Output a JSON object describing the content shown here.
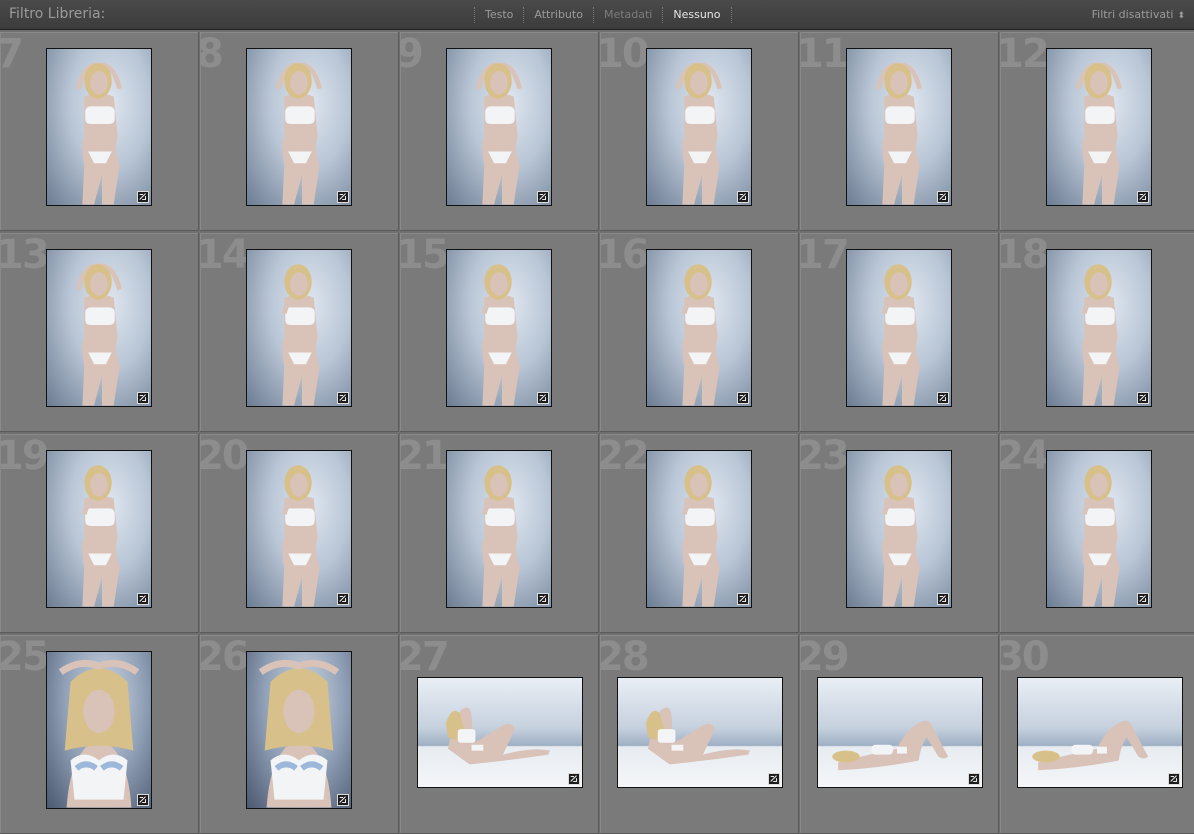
{
  "filter_bar": {
    "title": "Filtro Libreria:",
    "modes": [
      {
        "label": "Testo",
        "state": "normal"
      },
      {
        "label": "Attributo",
        "state": "normal"
      },
      {
        "label": "Metadati",
        "state": "dim"
      },
      {
        "label": "Nessuno",
        "state": "active"
      }
    ],
    "preset_label": "Filtri disattivati",
    "preset_arrow": "⬍"
  },
  "grid": {
    "cells": [
      {
        "number": "7",
        "orientation": "portrait",
        "pose": "front-arms-up"
      },
      {
        "number": "8",
        "orientation": "portrait",
        "pose": "front-arms-up"
      },
      {
        "number": "9",
        "orientation": "portrait",
        "pose": "back-arms-up"
      },
      {
        "number": "10",
        "orientation": "portrait",
        "pose": "side-arms-up"
      },
      {
        "number": "11",
        "orientation": "portrait",
        "pose": "side-arms-up"
      },
      {
        "number": "12",
        "orientation": "portrait",
        "pose": "side-arms-up"
      },
      {
        "number": "13",
        "orientation": "portrait",
        "pose": "back-arms-up"
      },
      {
        "number": "14",
        "orientation": "portrait",
        "pose": "three-quarter-hand-face"
      },
      {
        "number": "15",
        "orientation": "portrait",
        "pose": "three-quarter-hand-face"
      },
      {
        "number": "16",
        "orientation": "portrait",
        "pose": "three-quarter-hand-face"
      },
      {
        "number": "17",
        "orientation": "portrait",
        "pose": "three-quarter-hand-face"
      },
      {
        "number": "18",
        "orientation": "portrait",
        "pose": "three-quarter-hand-chest"
      },
      {
        "number": "19",
        "orientation": "portrait",
        "pose": "three-quarter-hand-chin"
      },
      {
        "number": "20",
        "orientation": "portrait",
        "pose": "three-quarter-hand-chin"
      },
      {
        "number": "21",
        "orientation": "portrait",
        "pose": "three-quarter-hand-chin"
      },
      {
        "number": "22",
        "orientation": "portrait",
        "pose": "three-quarter-hand-neck"
      },
      {
        "number": "23",
        "orientation": "portrait",
        "pose": "three-quarter-hand-neck"
      },
      {
        "number": "24",
        "orientation": "portrait",
        "pose": "three-quarter-hand-chest"
      },
      {
        "number": "25",
        "orientation": "portrait",
        "pose": "closeup-arms-up"
      },
      {
        "number": "26",
        "orientation": "portrait",
        "pose": "closeup-arms-up"
      },
      {
        "number": "27",
        "orientation": "landscape",
        "pose": "reclining-sitting"
      },
      {
        "number": "28",
        "orientation": "landscape",
        "pose": "reclining-sitting"
      },
      {
        "number": "29",
        "orientation": "landscape",
        "pose": "lying-knees-up"
      },
      {
        "number": "30",
        "orientation": "landscape",
        "pose": "lying-knees-up"
      }
    ]
  },
  "badge_icon": "develop-adjusted-icon",
  "colors": {
    "background": "#6f6f6f",
    "cell": "#7a7a7a",
    "number": "#8d8d8d",
    "active_mode": "#e6e6e6"
  }
}
